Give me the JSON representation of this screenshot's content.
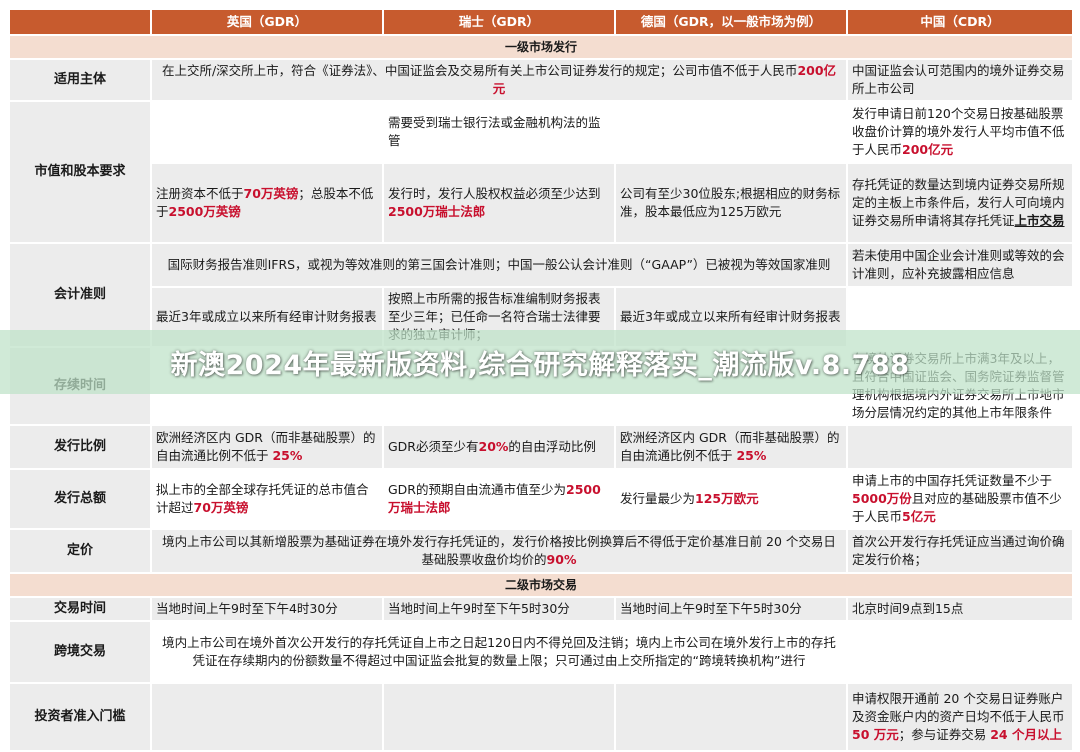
{
  "headers": [
    "",
    "英国（GDR）",
    "瑞士（GDR）",
    "德国（GDR，以一般市场为例）",
    "中国（CDR）"
  ],
  "sections": {
    "primary": "一级市场发行",
    "secondary": "二级市场交易"
  },
  "rows": {
    "subject": {
      "label": "适用主体",
      "merged_pre": "在上交所/深交所上市，符合《证券法》、中国证监会及交易所有关上市公司证券发行的规定；公司市值不低于人民币",
      "merged_red": "200亿元",
      "china": "中国证监会认可范围内的境外证券交易所上市公司"
    },
    "cap": {
      "label": "市值和股本要求",
      "swiss_top": "需要受到瑞士银行法或金融机构法的监管",
      "china_top_pre": "发行申请日前120个交易日按基础股票收盘价计算的境外发行人平均市值不低于人民币",
      "china_top_red": "200亿元",
      "uk_bottom_pre": "注册资本不低于",
      "uk_bottom_red1": "70万英镑",
      "uk_bottom_mid": "；总股本不低于",
      "uk_bottom_red2": "2500万英镑",
      "swiss_bottom_pre": "发行时，发行人股权权益必须至少达到",
      "swiss_bottom_red": "2500万瑞士法郎",
      "germany_bottom": "公司有至少30位股东;根据相应的财务标准，股本最低应为125万欧元",
      "china_bottom_pre": "存托凭证的数量达到境内证券交易所规定的主板上市条件后，发行人可向境内证券交易所申请将其存托凭证",
      "china_bottom_ul": "上市交易"
    },
    "accounting": {
      "label": "会计准则",
      "merged_top": "国际财务报告准则IFRS，或视为等效准则的第三国会计准则；中国一般公认会计准则（“GAAP”）已被视为等效国家准则",
      "china_top": "若未使用中国企业会计准则或等效的会计准则，应补充披露相应信息",
      "uk_bottom": "最近3年或成立以来所有经审计财务报表",
      "swiss_bottom": "按照上市所需的报告标准编制财务报表至少三年；已任命一名符合瑞士法律要求的独立审计师；",
      "germany_bottom": "最近3年或成立以来所有经审计财务报表"
    },
    "duration": {
      "label": "存续时间",
      "china": "在境外证券交易所上市满3年及以上，且符合中国证监会、国务院证券监督管理机构根据境内外证券交易所上市地市场分层情况约定的其他上市年限条件"
    },
    "ratio": {
      "label": "发行比例",
      "uk_pre": "欧洲经济区内 GDR（而非基础股票）的自由流通比例不低于 ",
      "uk_red": "25%",
      "swiss_pre": "GDR必须至少有",
      "swiss_red": "20%",
      "swiss_post": "的自由浮动比例",
      "germany_pre": "欧洲经济区内 GDR（而非基础股票）的自由流通比例不低于 ",
      "germany_red": "25%"
    },
    "amount": {
      "label": "发行总额",
      "uk_pre": "拟上市的全部全球存托凭证的总市值合计超过",
      "uk_red": "70万英镑",
      "swiss_pre": "GDR的预期自由流通市值至少为",
      "swiss_red": "2500万瑞士法郎",
      "germany_pre": "发行量最少为",
      "germany_red": "125万欧元",
      "china_pre": "申请上市的中国存托凭证数量不少于",
      "china_red1": "5000万份",
      "china_mid": "且对应的基础股票市值不少于人民币",
      "china_red2": "5亿元"
    },
    "pricing": {
      "label": "定价",
      "merged_pre": "境内上市公司以其新增股票为基础证券在境外发行存托凭证的，发行价格按比例换算后不得低于定价基准日前 20 个交易日基础股票收盘价均价的",
      "merged_red": "90%",
      "china": "首次公开发行存托凭证应当通过询价确定发行价格；"
    },
    "time": {
      "label": "交易时间",
      "uk": "当地时间上午9时至下午4时30分",
      "swiss": "当地时间上午9时至下午5时30分",
      "germany": "当地时间上午9时至下午5时30分",
      "china": "北京时间9点到15点"
    },
    "cross": {
      "label": "跨境交易",
      "merged": "境内上市公司在境外首次公开发行的存托凭证自上市之日起120日内不得兑回及注销；境内上市公司在境外发行上市的存托凭证在存续期内的份额数量不得超过中国证监会批复的数量上限；只可通过由上交所指定的“跨境转换机构”进行"
    },
    "investor": {
      "label": "投资者准入门槛",
      "china_pre": "申请权限开通前 20 个交易日证券账户及资金账户内的资产日均不低于人民币 ",
      "china_red1": "50 万元",
      "china_mid": "；参与证券交易 ",
      "china_red2": "24 个月以上"
    }
  },
  "banner": "新澳2024年最新版资料,综合研究解释落实_潮流版v.8.788"
}
